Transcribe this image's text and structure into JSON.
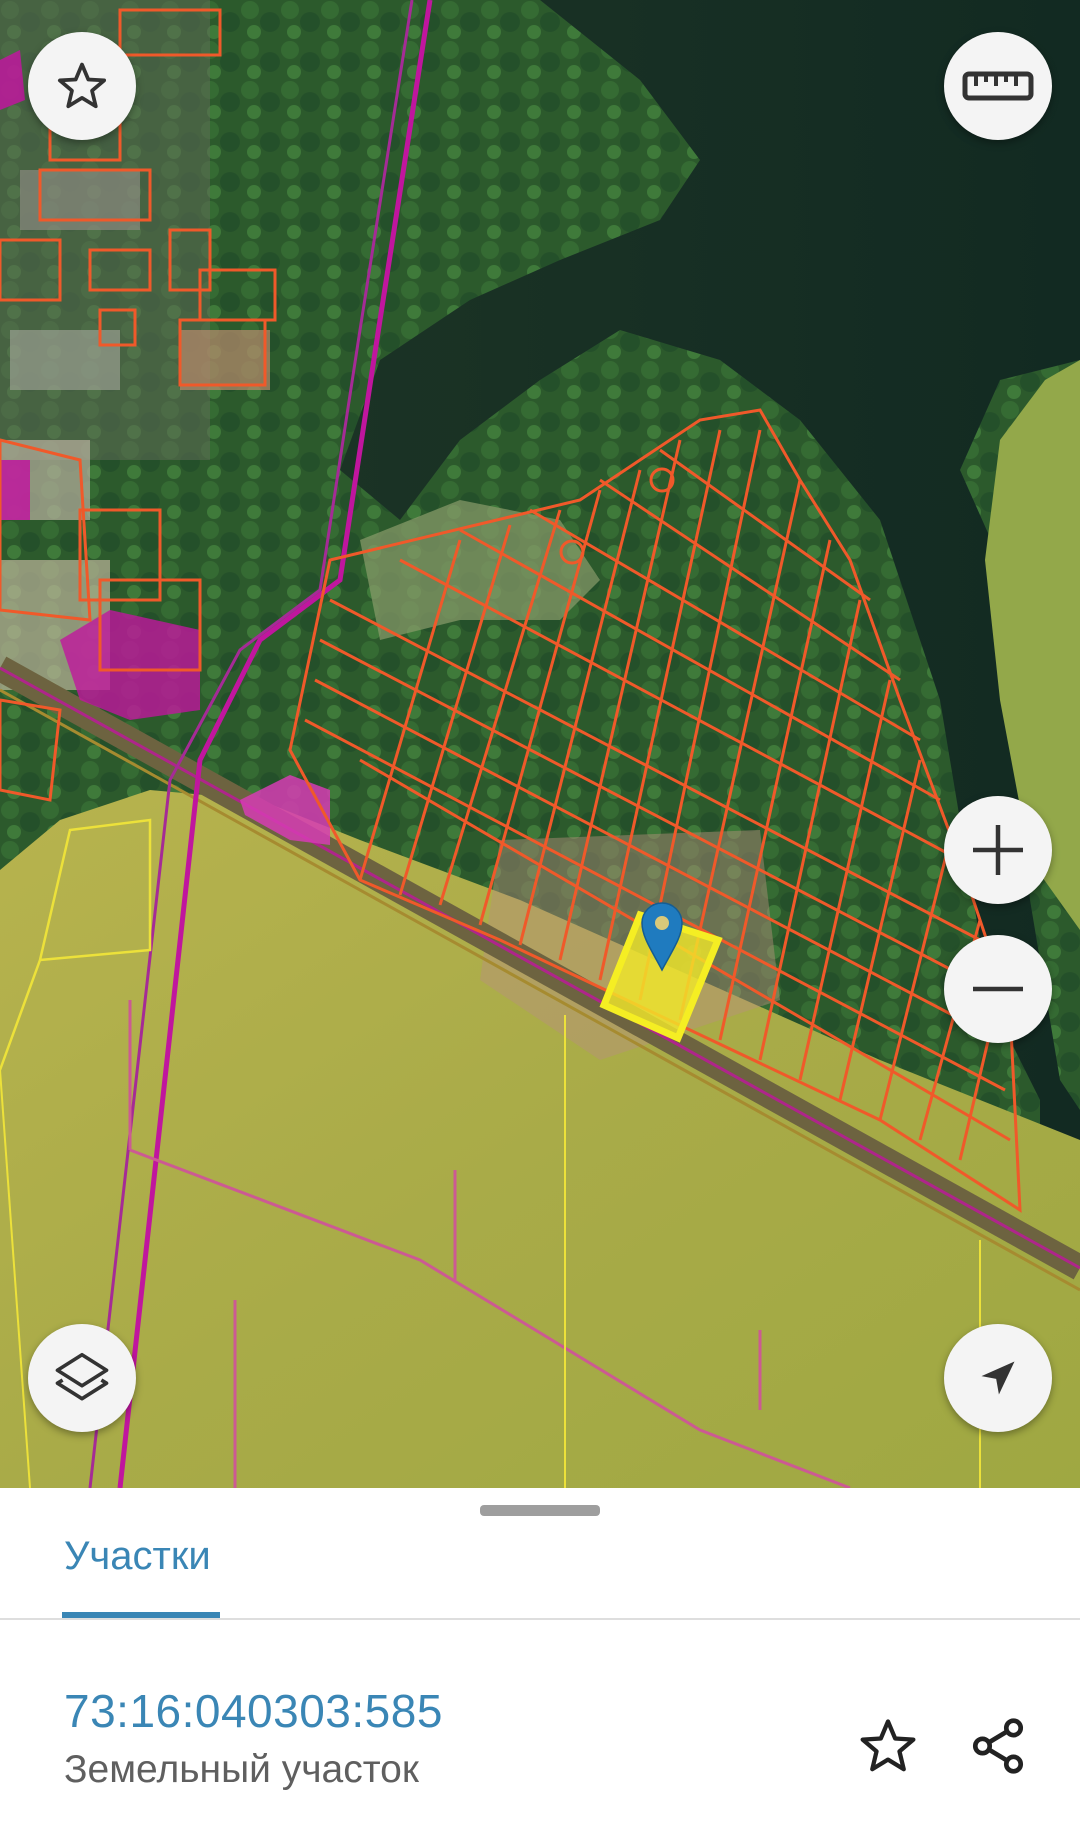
{
  "map": {
    "basemap": "satellite",
    "selected_parcel_color": "#f2e829",
    "parcel_boundary_color": "#f0592a",
    "zone_color": "#c0169e",
    "field_boundary_color": "#ece13a",
    "marker_color": "#1f7bbf",
    "controls": {
      "favorite_icon": "star-outline-icon",
      "measure_icon": "ruler-icon",
      "zoom_in_icon": "plus-icon",
      "zoom_out_icon": "minus-icon",
      "layers_icon": "layers-icon",
      "locate_icon": "navigation-arrow-icon"
    }
  },
  "sheet": {
    "tabs": [
      {
        "label": "Участки",
        "active": true
      }
    ],
    "accent_color": "#3a86b5",
    "parcel": {
      "number": "73:16:040303:585",
      "type": "Земельный участок"
    },
    "actions": {
      "favorite_icon": "star-outline-icon",
      "share_icon": "share-icon"
    }
  }
}
